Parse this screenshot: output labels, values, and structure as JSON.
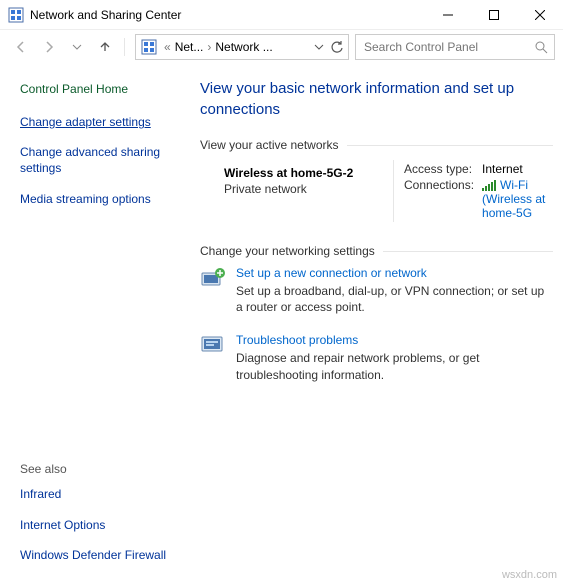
{
  "window": {
    "title": "Network and Sharing Center"
  },
  "address": {
    "crumb1": "Net...",
    "crumb2": "Network ..."
  },
  "search": {
    "placeholder": "Search Control Panel"
  },
  "sidebar": {
    "home": "Control Panel Home",
    "links": {
      "adapter": "Change adapter settings",
      "advanced": "Change advanced sharing settings",
      "media": "Media streaming options"
    },
    "seealso_hdr": "See also",
    "seealso": {
      "infrared": "Infrared",
      "internet": "Internet Options",
      "firewall": "Windows Defender Firewall"
    }
  },
  "main": {
    "title": "View your basic network information and set up connections",
    "active_hdr": "View your active networks",
    "network": {
      "name": "Wireless at home-5G-2",
      "type": "Private network",
      "access_lbl": "Access type:",
      "access_val": "Internet",
      "conn_lbl": "Connections:",
      "conn_val": "Wi-Fi (Wireless at home-5G"
    },
    "change_hdr": "Change your networking settings",
    "setup": {
      "title": "Set up a new connection or network",
      "desc": "Set up a broadband, dial-up, or VPN connection; or set up a router or access point."
    },
    "trouble": {
      "title": "Troubleshoot problems",
      "desc": "Diagnose and repair network problems, or get troubleshooting information."
    }
  },
  "watermark": "wsxdn.com"
}
